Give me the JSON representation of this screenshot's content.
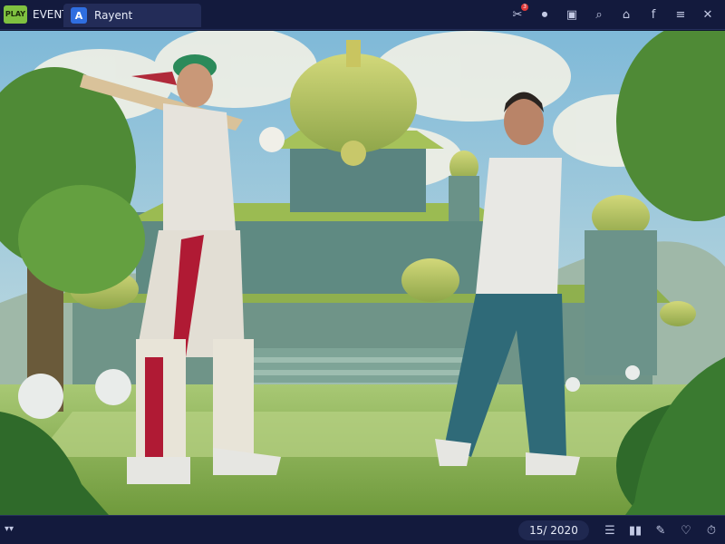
{
  "app": {
    "logo_text": "PLAY",
    "event_label": "EVENT"
  },
  "tab": {
    "icon_letter": "A",
    "label": "Rayent"
  },
  "toolbar_icons": [
    {
      "name": "bat-notification-icon",
      "glyph": "✂",
      "badge": "3"
    },
    {
      "name": "record-icon",
      "glyph": "⏺"
    },
    {
      "name": "info-icon",
      "glyph": "▣"
    },
    {
      "name": "search-icon",
      "glyph": "⌕"
    },
    {
      "name": "home-icon",
      "glyph": "⌂"
    },
    {
      "name": "facebook-icon",
      "glyph": "f"
    },
    {
      "name": "menu-icon",
      "glyph": "≡"
    },
    {
      "name": "close-icon",
      "glyph": "✕"
    }
  ],
  "bottom": {
    "left_glyph": "▾▾",
    "counter": "15/ 2020"
  },
  "bottom_icons": [
    {
      "name": "list-icon",
      "glyph": "☰"
    },
    {
      "name": "stats-icon",
      "glyph": "▮▮"
    },
    {
      "name": "edit-icon",
      "glyph": "✎"
    },
    {
      "name": "like-icon",
      "glyph": "♡"
    },
    {
      "name": "timer-icon",
      "glyph": "⏱"
    }
  ],
  "colors": {
    "chrome_bg": "#131a3d",
    "tab_bg": "#232c58",
    "accent_blue": "#2f6ee0",
    "logo_green": "#7fc140"
  }
}
